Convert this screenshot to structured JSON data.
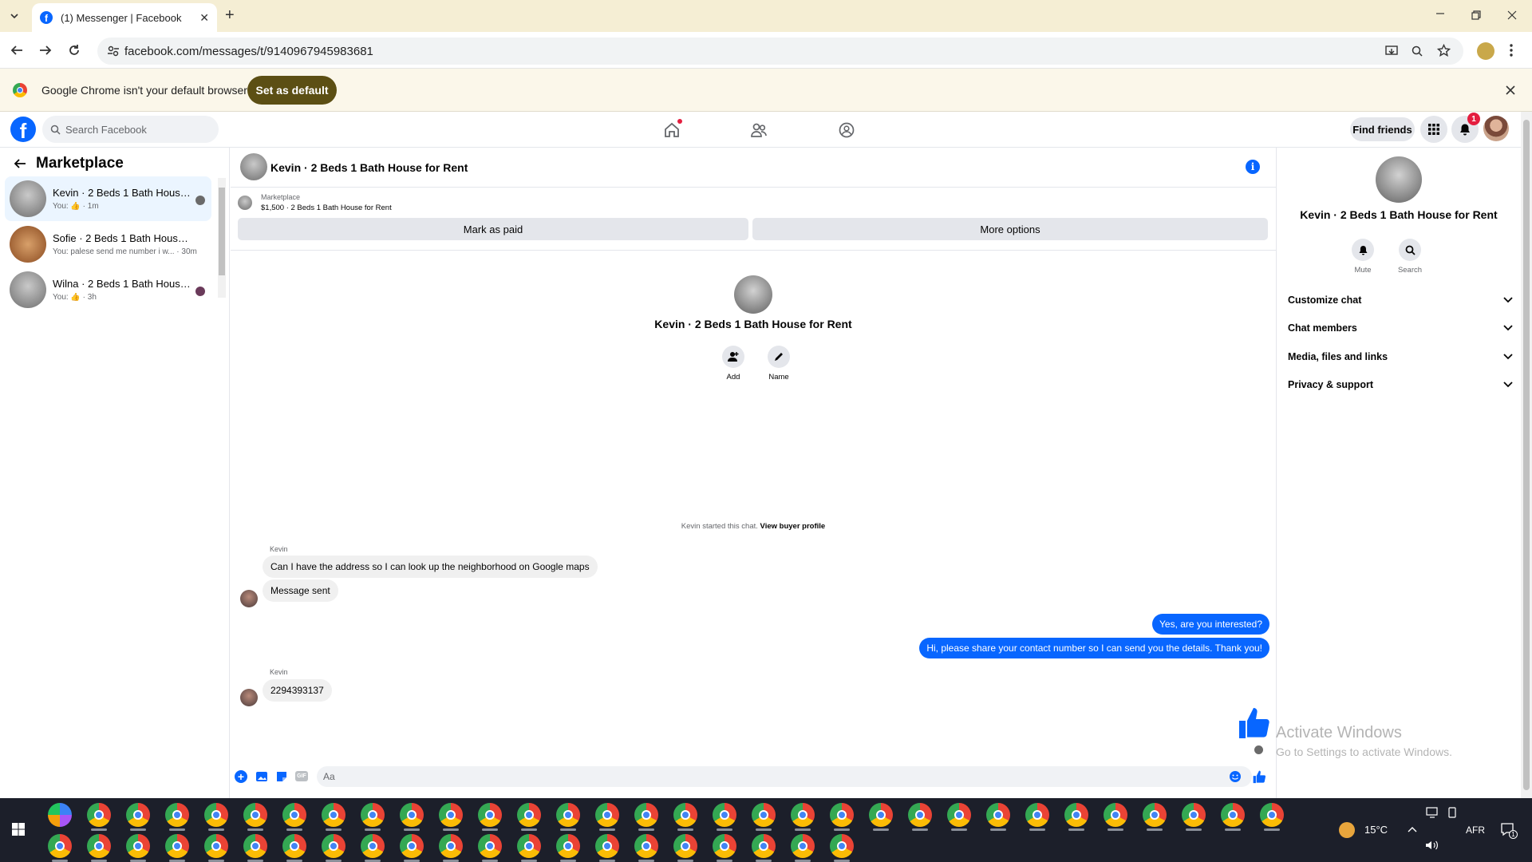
{
  "browser": {
    "tab_title": "(1) Messenger | Facebook",
    "url": "facebook.com/messages/t/9140967945983681",
    "infobar_text": "Google Chrome isn't your default browser",
    "set_default_label": "Set as default"
  },
  "fb": {
    "search_placeholder": "Search Facebook",
    "find_friends_label": "Find friends",
    "notification_count": "1"
  },
  "sidebar": {
    "title": "Marketplace",
    "conversations": [
      {
        "title": "Kevin · 2 Beds 1 Bath House f...",
        "subtitle": "You: 👍 · 1m",
        "active": true
      },
      {
        "title": "Sofie · 2 Beds 1 Bath House for ...",
        "subtitle": "You: palese send me number i w... · 30m",
        "active": false
      },
      {
        "title": "Wilna · 2 Beds 1 Bath House f...",
        "subtitle": "You: 👍 · 3h",
        "active": false
      }
    ]
  },
  "chat": {
    "header_title": "Kevin · 2 Beds 1 Bath House for Rent",
    "listing_source": "Marketplace",
    "listing_desc": "$1,500 · 2 Beds 1 Bath House for Rent",
    "mark_paid_label": "Mark as paid",
    "more_options_label": "More options",
    "profile_name": "Kevin · 2 Beds 1 Bath House for Rent",
    "add_label": "Add",
    "name_label": "Name",
    "started_text": "Kevin started this chat.",
    "view_buyer_label": "View buyer profile",
    "messages": [
      {
        "sender": "Kevin",
        "text": "Can I have the address so I can look up the neighborhood on Google maps",
        "dir": "in"
      },
      {
        "sender": "",
        "text": "Message sent",
        "dir": "in"
      },
      {
        "sender": "",
        "text": "Yes, are you interested?",
        "dir": "out"
      },
      {
        "sender": "",
        "text": "Hi, please share your contact number so I can send you the details. Thank you!",
        "dir": "out"
      },
      {
        "sender": "Kevin",
        "text": "2294393137",
        "dir": "in"
      }
    ],
    "composer_placeholder": "Aa"
  },
  "details": {
    "title": "Kevin · 2 Beds 1 Bath House for Rent",
    "mute_label": "Mute",
    "search_label": "Search",
    "sections": [
      "Customize chat",
      "Chat members",
      "Media, files and links",
      "Privacy & support"
    ]
  },
  "watermark": {
    "line1": "Activate Windows",
    "line2": "Go to Settings to activate Windows."
  },
  "taskbar": {
    "temperature": "15°C",
    "language": "AFR",
    "notif_count": "1"
  },
  "colors": {
    "fb_blue": "#0866ff",
    "infobar_btn": "#5c4f14",
    "tab_strip": "#f5eed4"
  }
}
